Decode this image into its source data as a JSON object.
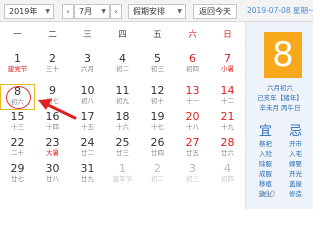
{
  "toolbar": {
    "year_value": "2019年",
    "month_value": "7月",
    "holiday_value": "假期安排",
    "prev_label": "‹",
    "next_label": "›",
    "today_label": "返回今天"
  },
  "header_date": "2019-07-08 星期一",
  "weekdays": [
    "一",
    "二",
    "三",
    "四",
    "五",
    "六",
    "日"
  ],
  "weeks": [
    [
      {
        "day": "1",
        "lunar": "建党节",
        "fest": true
      },
      {
        "day": "2",
        "lunar": "三十"
      },
      {
        "day": "3",
        "lunar": "六月"
      },
      {
        "day": "4",
        "lunar": "初二"
      },
      {
        "day": "5",
        "lunar": "初三"
      },
      {
        "day": "6",
        "lunar": "初四",
        "weekend": true
      },
      {
        "day": "7",
        "lunar": "小暑",
        "weekend": true,
        "fest": true
      }
    ],
    [
      {
        "day": "8",
        "lunar": "初六",
        "today": true
      },
      {
        "day": "9",
        "lunar": "初七"
      },
      {
        "day": "10",
        "lunar": "初八"
      },
      {
        "day": "11",
        "lunar": "初九"
      },
      {
        "day": "12",
        "lunar": "初十"
      },
      {
        "day": "13",
        "lunar": "十一",
        "weekend": true
      },
      {
        "day": "14",
        "lunar": "十二",
        "weekend": true
      }
    ],
    [
      {
        "day": "15",
        "lunar": "十三"
      },
      {
        "day": "16",
        "lunar": "十四"
      },
      {
        "day": "17",
        "lunar": "十五"
      },
      {
        "day": "18",
        "lunar": "十六"
      },
      {
        "day": "19",
        "lunar": "十七"
      },
      {
        "day": "20",
        "lunar": "十八",
        "weekend": true
      },
      {
        "day": "21",
        "lunar": "十九",
        "weekend": true
      }
    ],
    [
      {
        "day": "22",
        "lunar": "二十"
      },
      {
        "day": "23",
        "lunar": "大暑",
        "fest": true
      },
      {
        "day": "24",
        "lunar": "廿二"
      },
      {
        "day": "25",
        "lunar": "廿三"
      },
      {
        "day": "26",
        "lunar": "廿四"
      },
      {
        "day": "27",
        "lunar": "廿五",
        "weekend": true
      },
      {
        "day": "28",
        "lunar": "廿六",
        "weekend": true
      }
    ],
    [
      {
        "day": "29",
        "lunar": "廿七"
      },
      {
        "day": "30",
        "lunar": "廿八"
      },
      {
        "day": "31",
        "lunar": "廿九"
      },
      {
        "day": "1",
        "lunar": "建军节",
        "dim": true
      },
      {
        "day": "2",
        "lunar": "初二",
        "dim": true
      },
      {
        "day": "3",
        "lunar": "初三",
        "dim": true,
        "weekend": true
      },
      {
        "day": "4",
        "lunar": "初四",
        "dim": true,
        "weekend": true
      }
    ]
  ],
  "side": {
    "big_day": "8",
    "lunar_date": "六月初六",
    "ganzhi_year": "己亥年【猪年】",
    "ganzhi_month_day": "辛未月 丙午日",
    "yi_label": "宜",
    "ji_label": "忌",
    "yi_items": [
      "祭祀",
      "入殓",
      "除服",
      "成服",
      "移柩",
      "破土"
    ],
    "ji_items": [
      "开市",
      "入宅",
      "嫁娶",
      "开光",
      "盖屋",
      "修造"
    ],
    "watermark": "360"
  },
  "colors": {
    "accent_blue": "#2c6db5",
    "today_orange": "#f7a81b",
    "weekend_red": "#e02020",
    "highlight_border": "#e8b820"
  }
}
